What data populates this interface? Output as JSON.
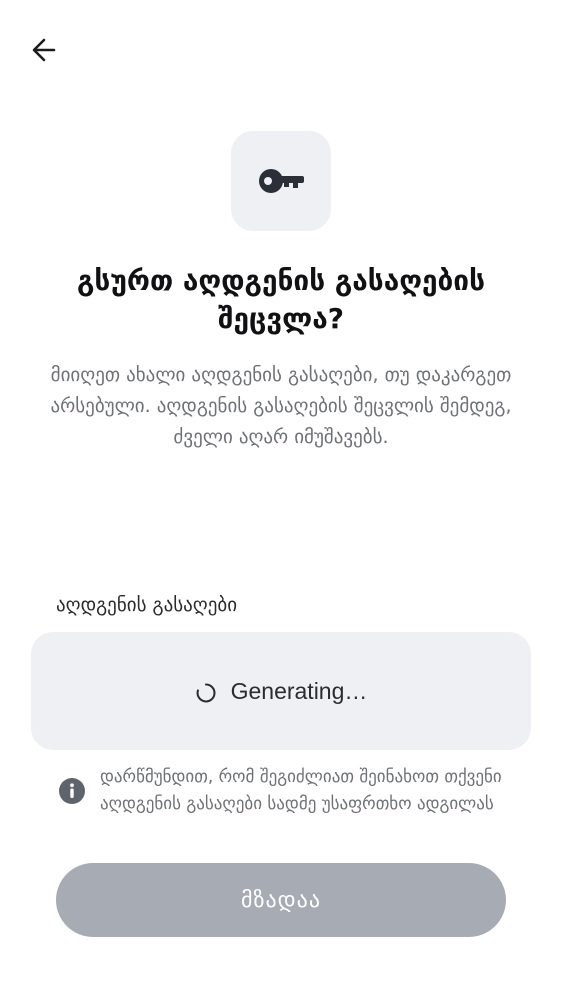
{
  "header": {
    "back_icon": "arrow-left-icon"
  },
  "hero": {
    "icon": "key-icon",
    "title": "გსურთ აღდგენის გასაღების შეცვლა?",
    "description": "მიიღეთ ახალი აღდგენის გასაღები, თუ დაკარგეთ არსებული. აღდგენის გასაღების შეცვლის შემდეგ, ძველი აღარ იმუშავებს."
  },
  "recovery_key": {
    "label": "აღდგენის გასაღები",
    "status_icon": "spinner-icon",
    "status_text": "Generating…"
  },
  "notice": {
    "icon": "info-icon",
    "text": "დარწმუნდით, რომ შეგიძლიათ შეინახოთ თქვენი აღდგენის გასაღები სადმე უსაფრთხო ადგილას"
  },
  "actions": {
    "ready_label": "მზადაა",
    "ready_enabled": false
  },
  "colors": {
    "tile_background": "#eff0f4",
    "button_disabled": "#a7abb3",
    "text_secondary": "#6e7077",
    "icon": "#2b2f38"
  }
}
